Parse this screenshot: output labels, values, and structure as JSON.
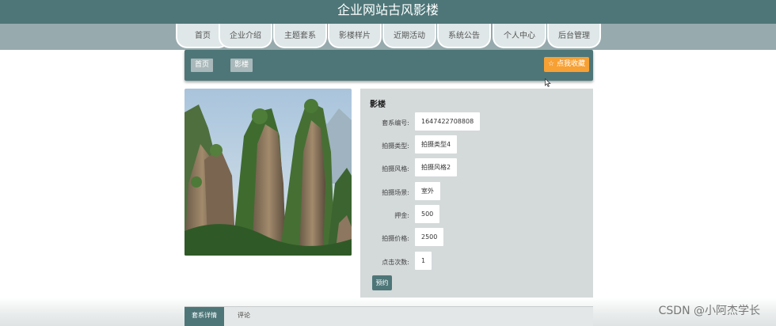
{
  "site": {
    "title": "企业网站古风影楼"
  },
  "nav": {
    "items": [
      {
        "label": "首页"
      },
      {
        "label": "企业介绍"
      },
      {
        "label": "主题套系"
      },
      {
        "label": "影楼样片"
      },
      {
        "label": "近期活动"
      },
      {
        "label": "系统公告"
      },
      {
        "label": "个人中心"
      },
      {
        "label": "后台管理"
      }
    ]
  },
  "breadcrumb": {
    "home": "首页",
    "separator": "/",
    "current": "影楼"
  },
  "favorite_button": {
    "label": "☆ 点我收藏"
  },
  "detail": {
    "title": "影楼",
    "fields": [
      {
        "label": "套系编号:",
        "value": "1647422708808"
      },
      {
        "label": "拍摄类型:",
        "value": "拍摄类型4"
      },
      {
        "label": "拍摄风格:",
        "value": "拍摄风格2"
      },
      {
        "label": "拍摄场景:",
        "value": "室外"
      },
      {
        "label": "押金:",
        "value": "500"
      },
      {
        "label": "拍摄价格:",
        "value": "2500"
      },
      {
        "label": "点击次数:",
        "value": "1"
      }
    ],
    "book_button": "预约"
  },
  "tabs": [
    {
      "label": "套系详情",
      "active": true
    },
    {
      "label": "评论",
      "active": false
    }
  ],
  "watermark": "CSDN @小阿杰学长",
  "colors": {
    "header": "#4e7678",
    "nav_bar": "#97aaad",
    "accent_orange": "#f7a034",
    "panel": "#d4d9da"
  }
}
